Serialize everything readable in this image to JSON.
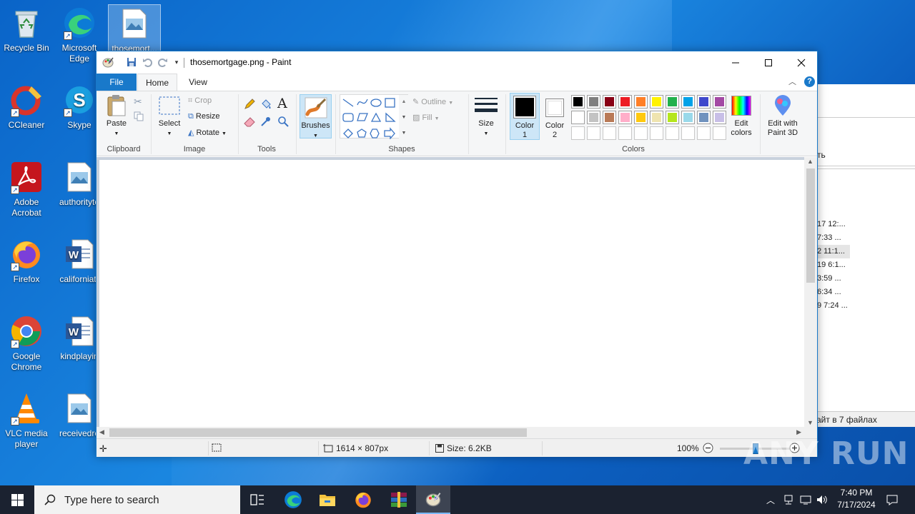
{
  "desktop": {
    "icons": [
      {
        "label": "Recycle Bin"
      },
      {
        "label": "Microsoft Edge"
      },
      {
        "label": "thosemort..."
      },
      {
        "label": "CCleaner"
      },
      {
        "label": "Skype"
      },
      {
        "label": "Adobe Acrobat"
      },
      {
        "label": "authorityto"
      },
      {
        "label": "Firefox"
      },
      {
        "label": "californiatr"
      },
      {
        "label": "Google Chrome"
      },
      {
        "label": "kindplayin"
      },
      {
        "label": "VLC media player"
      },
      {
        "label": "receivedre"
      }
    ]
  },
  "background_window": {
    "header_fragment": "ть",
    "rows": [
      "17 12:...",
      "7:33 ...",
      "2 11:1...",
      "19 6:1...",
      "3:59 ...",
      "6:34 ...",
      "9 7:24 ..."
    ],
    "status_fragment": "айт в 7 файлах"
  },
  "paint": {
    "title": "thosemortgage.png - Paint",
    "tabs": {
      "file": "File",
      "home": "Home",
      "view": "View"
    },
    "groups": {
      "clipboard": "Clipboard",
      "image": "Image",
      "tools": "Tools",
      "shapes": "Shapes",
      "colors": "Colors"
    },
    "buttons": {
      "paste": "Paste",
      "select": "Select",
      "crop": "Crop",
      "resize": "Resize",
      "rotate": "Rotate",
      "brushes": "Brushes",
      "outline": "Outline",
      "fill": "Fill",
      "size": "Size",
      "color1": "Color\n1",
      "color2": "Color\n2",
      "edit_colors": "Edit\ncolors",
      "edit_paint3d": "Edit with\nPaint 3D"
    },
    "palette": {
      "row1": [
        "#000000",
        "#7f7f7f",
        "#880015",
        "#ed1c24",
        "#ff7f27",
        "#fff200",
        "#22b14c",
        "#00a2e8",
        "#3f48cc",
        "#a349a4"
      ],
      "row2": [
        "#ffffff",
        "#c3c3c3",
        "#b97a57",
        "#ffaec9",
        "#ffc90e",
        "#efe4b0",
        "#b5e61d",
        "#99d9ea",
        "#7092be",
        "#c8bfe7"
      ],
      "row3": [
        "#ffffff",
        "#ffffff",
        "#ffffff",
        "#ffffff",
        "#ffffff",
        "#ffffff",
        "#ffffff",
        "#ffffff",
        "#ffffff",
        "#ffffff"
      ]
    },
    "color1": "#000000",
    "color2": "#ffffff",
    "status": {
      "dimensions": "1614 × 807px",
      "size": "Size: 6.2KB",
      "zoom": "100%",
      "zoom_level": 0.5
    }
  },
  "taskbar": {
    "search_placeholder": "Type here to search",
    "time": "7:40 PM",
    "date": "7/17/2024"
  },
  "watermark": "ANY RUN"
}
